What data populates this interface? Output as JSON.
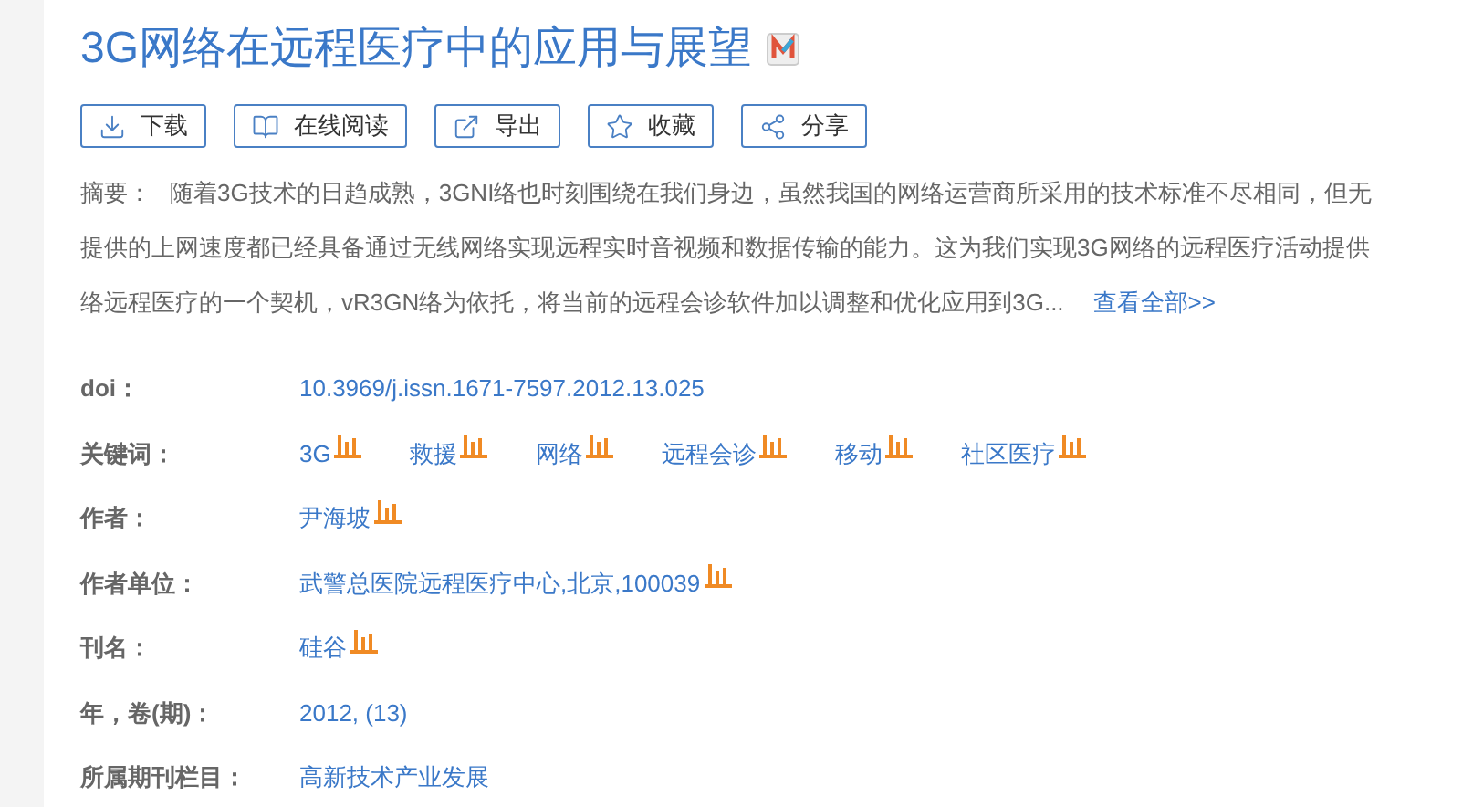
{
  "title": "3G网络在远程医疗中的应用与展望",
  "actions": [
    {
      "kind": "download",
      "label": "下载"
    },
    {
      "kind": "read",
      "label": "在线阅读"
    },
    {
      "kind": "export",
      "label": "导出"
    },
    {
      "kind": "favorite",
      "label": "收藏"
    },
    {
      "kind": "share",
      "label": "分享"
    }
  ],
  "abstract": {
    "label": "摘要：",
    "lines": [
      "随着3G技术的日趋成熟，3GNI络也时刻围绕在我们身边，虽然我国的网络运营商所采用的技术标准不尽相同，但无",
      "提供的上网速度都已经具备通过无线网络实现远程实时音视频和数据传输的能力。这为我们实现3G网络的远程医疗活动提供",
      "络远程医疗的一个契机，vR3GN络为依托，将当前的远程会诊软件加以调整和优化应用到3G..."
    ],
    "more": "查看全部>>"
  },
  "fields": [
    {
      "label": "doi：",
      "values": [
        {
          "text": "10.3969/j.issn.1671-7597.2012.13.025",
          "stats": false
        }
      ]
    },
    {
      "label": "关键词：",
      "values": [
        {
          "text": "3G",
          "stats": true
        },
        {
          "text": "救援",
          "stats": true
        },
        {
          "text": "网络",
          "stats": true
        },
        {
          "text": "远程会诊",
          "stats": true
        },
        {
          "text": "移动",
          "stats": true
        },
        {
          "text": "社区医疗",
          "stats": true
        }
      ]
    },
    {
      "label": "作者：",
      "values": [
        {
          "text": "尹海坡",
          "stats": true
        }
      ]
    },
    {
      "label": "作者单位：",
      "values": [
        {
          "text": "武警总医院远程医疗中心,北京,100039",
          "stats": true
        }
      ]
    },
    {
      "label": "刊名：",
      "values": [
        {
          "text": "硅谷",
          "stats": true
        }
      ]
    },
    {
      "label": "年，卷(期)：",
      "values": [
        {
          "text": "2012, (13)",
          "stats": false
        }
      ]
    },
    {
      "label": "所属期刊栏目：",
      "values": [
        {
          "text": "高新技术产业发展",
          "stats": false
        }
      ]
    }
  ]
}
